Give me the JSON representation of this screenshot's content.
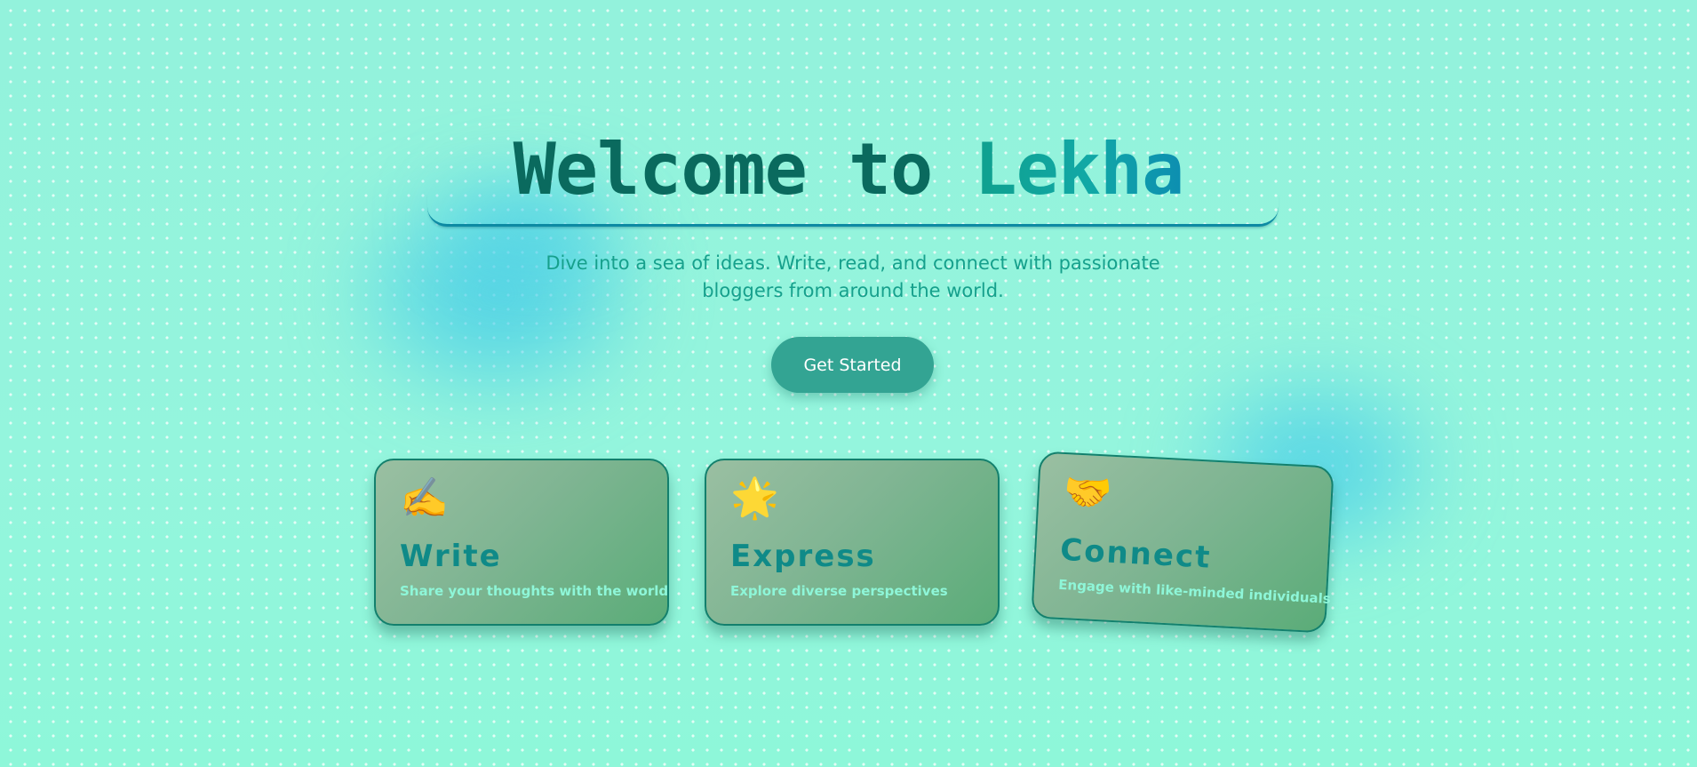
{
  "hero": {
    "title_part1": "Welcome to ",
    "title_part2": "Lekha",
    "subtitle": "Dive into a sea of ideas. Write, read, and connect with passionate bloggers from around the world.",
    "cta_label": "Get Started"
  },
  "cards": [
    {
      "icon": "✍️",
      "icon_name": "writing-hand-icon",
      "title": "Write",
      "description": "Share your thoughts with the world"
    },
    {
      "icon": "🌟",
      "icon_name": "glowing-star-icon",
      "title": "Express",
      "description": "Explore diverse perspectives"
    },
    {
      "icon": "🤝",
      "icon_name": "handshake-icon",
      "title": "Connect",
      "description": "Engage with like-minded individuals"
    }
  ],
  "colors": {
    "background": "#8ff5dc",
    "title_dark": "#0a6a5e",
    "title_accent": "#10a295",
    "subtitle": "#16a08c",
    "button": "#33a493",
    "card_border": "#13806d",
    "card_title": "#0f8a88",
    "card_desc": "#8ef6d8",
    "blob": "#3dc8e8"
  }
}
